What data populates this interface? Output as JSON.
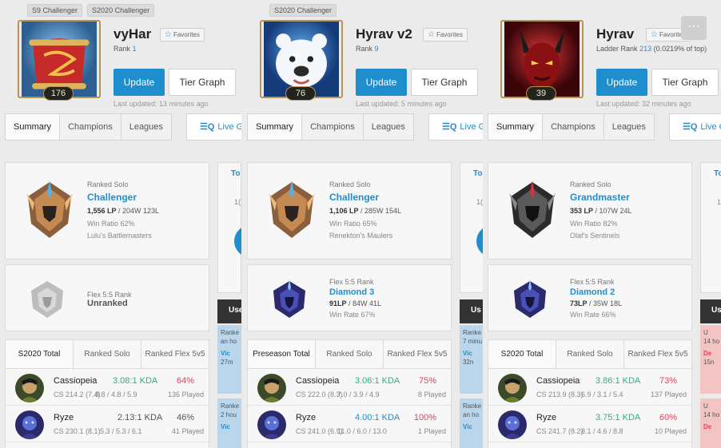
{
  "panels": [
    {
      "badges": [
        "S9 Challenger",
        "S2020 Challenger"
      ],
      "name": "vyHar",
      "favorites": "Favorites",
      "rank_prefix": "Rank",
      "rank_num": "1",
      "rank_suffix": "",
      "level": "176",
      "update": "Update",
      "tier_graph": "Tier Graph",
      "last_updated": "Last updated: 13 minutes ago",
      "tabs": [
        "Summary",
        "Champions",
        "Leagues"
      ],
      "live": "Live G",
      "solo": {
        "label": "Ranked Solo",
        "tier": "Challenger",
        "lp": "1,556 LP",
        "record": " / 204W 123L",
        "winratio": "Win Ratio 62%",
        "league": "Lulu's Battlemasters"
      },
      "flex": {
        "label": "Flex 5:5 Rank",
        "tier": "Unranked",
        "lp": "",
        "record": "",
        "winrate": ""
      },
      "stat_tabs": [
        "S2020 Total",
        "Ranked Solo",
        "Ranked Flex 5v5"
      ],
      "champions": [
        {
          "name": "Cassiopeia",
          "kda": "3.08:1 KDA",
          "winrate": "64%",
          "cs": "CS 214.2 (7.4)",
          "kline": "8.8 / 4.8 / 5.9",
          "played": "136 Played"
        },
        {
          "name": "Ryze",
          "kda": "2.13:1 KDA",
          "winrate": "46%",
          "cs": "CS 230.1 (8.1)",
          "kline": "5.3 / 5.3 / 6.1",
          "played": "41 Played"
        }
      ],
      "side": {
        "top": "To",
        "one": "1(",
        "bar": "Use",
        "rk_a_label": "Ranke",
        "rk_a_time": "an ho",
        "rk_a_vc": "Vic",
        "rk_a_extra": "27m",
        "rk_b_label": "Ranke",
        "rk_b_time": "2 hou",
        "rk_b_vc": "Vic"
      }
    },
    {
      "badges": [
        "S2020 Challenger"
      ],
      "name": "Hyrav v2",
      "favorites": "Favorites",
      "rank_prefix": "Rank",
      "rank_num": "9",
      "rank_suffix": "",
      "level": "76",
      "update": "Update",
      "tier_graph": "Tier Graph",
      "last_updated": "Last updated: 5 minutes ago",
      "tabs": [
        "Summary",
        "Champions",
        "Leagues"
      ],
      "live": "Live G",
      "solo": {
        "label": "Ranked Solo",
        "tier": "Challenger",
        "lp": "1,106 LP",
        "record": " / 285W 154L",
        "winratio": "Win Ratio 65%",
        "league": "Renekton's Maulers"
      },
      "flex": {
        "label": "Flex 5:5 Rank",
        "tier": "Diamond 3",
        "lp": "91LP",
        "record": " / 84W 41L",
        "winrate": "Win Rate 67%"
      },
      "stat_tabs": [
        "Preseason Total",
        "Ranked Solo",
        "Ranked Flex 5v5"
      ],
      "champions": [
        {
          "name": "Cassiopeia",
          "kda": "3.06:1 KDA",
          "winrate": "75%",
          "cs": "CS 222.0 (8.3)",
          "kline": "7.0 / 3.9 / 4.9",
          "played": "8 Played"
        },
        {
          "name": "Ryze",
          "kda": "4.00:1 KDA",
          "winrate": "100%",
          "cs": "CS 241.0 (6.9)",
          "kline": "11.0 / 6.0 / 13.0",
          "played": "1 Played"
        }
      ],
      "side": {
        "top": "To",
        "one": "1(",
        "bar": "Us",
        "rk_a_label": "Ranke",
        "rk_a_time": "7 minu",
        "rk_a_vc": "Vic",
        "rk_a_extra": "32n",
        "rk_b_label": "Ranke",
        "rk_b_time": "an ho",
        "rk_b_vc": "Vic"
      }
    },
    {
      "badges": [],
      "name": "Hyrav",
      "favorites": "Favorites",
      "rank_prefix": "Ladder Rank",
      "rank_num": "213",
      "rank_suffix": "(0.0219% of top)",
      "level": "39",
      "update": "Update",
      "tier_graph": "Tier Graph",
      "last_updated": "Last updated: 32 minutes ago",
      "tabs": [
        "Summary",
        "Champions",
        "Leagues"
      ],
      "live": "Live G",
      "solo": {
        "label": "Ranked Solo",
        "tier": "Grandmaster",
        "lp": "353 LP",
        "record": " / 107W 24L",
        "winratio": "Win Ratio 82%",
        "league": "Olaf's Sentinels"
      },
      "flex": {
        "label": "Flex 5:5 Rank",
        "tier": "Diamond 2",
        "lp": "73LP",
        "record": " / 35W 18L",
        "winrate": "Win Rate 66%"
      },
      "stat_tabs": [
        "S2020 Total",
        "Ranked Solo",
        "Ranked Flex 5v5"
      ],
      "champions": [
        {
          "name": "Cassiopeia",
          "kda": "3.86:1 KDA",
          "winrate": "73%",
          "cs": "CS 213.9 (8.3)",
          "kline": "6.9 / 3.1 / 5.4",
          "played": "137 Played"
        },
        {
          "name": "Ryze",
          "kda": "3.75:1 KDA",
          "winrate": "60%",
          "cs": "CS 241.7 (8.2)",
          "kline": "8.1 / 4.6 / 8.8",
          "played": "10 Played"
        }
      ],
      "side": {
        "top": "To",
        "one": "1",
        "bar": "Us",
        "rk_a_label": "U",
        "rk_a_time": "14 ho",
        "rk_a_vc": "De",
        "rk_a_extra": "15n",
        "rk_b_label": "U",
        "rk_b_time": "14 ho",
        "rk_b_vc": "De"
      }
    }
  ],
  "menu_icon": "ellipsis-icon"
}
